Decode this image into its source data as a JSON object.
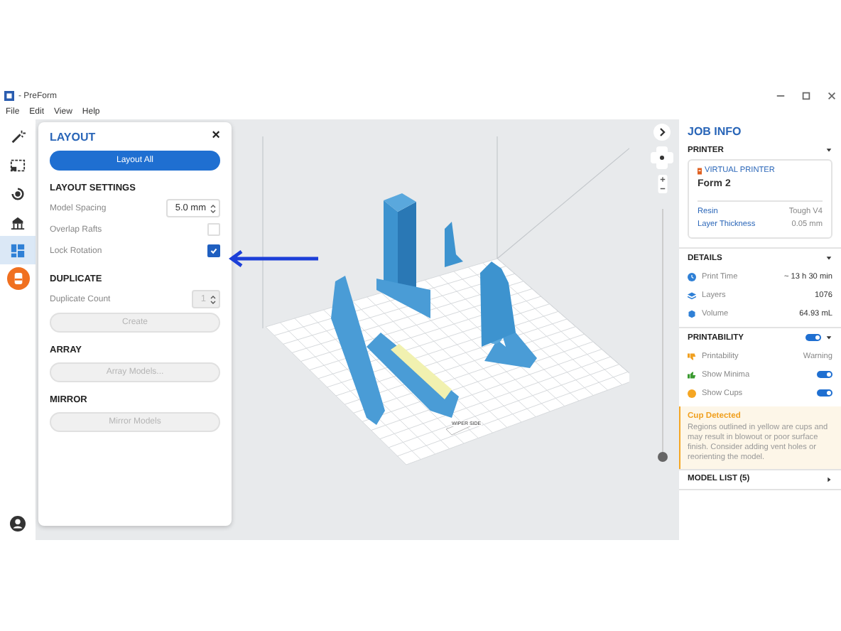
{
  "window": {
    "title": "- PreForm"
  },
  "menu": [
    "File",
    "Edit",
    "View",
    "Help"
  ],
  "toolbar": [
    {
      "kind": "wand",
      "selected": false
    },
    {
      "kind": "select",
      "selected": false
    },
    {
      "kind": "orient",
      "selected": false
    },
    {
      "kind": "supports",
      "selected": false
    },
    {
      "kind": "layout",
      "selected": true
    },
    {
      "kind": "print",
      "selected": false
    }
  ],
  "layout_panel": {
    "title": "LAYOUT",
    "close": "×",
    "layout_all": "Layout All",
    "sections": [
      {
        "heading": "LAYOUT SETTINGS",
        "rows": [
          {
            "kind": "spinner",
            "label": "Model Spacing",
            "value": "5.0 mm",
            "disabled": false
          },
          {
            "kind": "checkbox",
            "label": "Overlap Rafts",
            "checked": false
          },
          {
            "kind": "checkbox",
            "label": "Lock Rotation",
            "checked": true
          }
        ]
      },
      {
        "heading": "DUPLICATE",
        "rows": [
          {
            "kind": "spinner",
            "label": "Duplicate Count",
            "value": "1",
            "disabled": true
          },
          {
            "kind": "button",
            "label": "Create",
            "disabled": true
          }
        ]
      },
      {
        "heading": "ARRAY",
        "rows": [
          {
            "kind": "button",
            "label": "Array Models...",
            "disabled": true
          }
        ]
      },
      {
        "heading": "MIRROR",
        "rows": [
          {
            "kind": "button",
            "label": "Mirror Models",
            "disabled": true
          }
        ]
      }
    ]
  },
  "viewport": {
    "plate_label": "WIPER SIDE",
    "zoom": {
      "level": 0
    }
  },
  "job_info": {
    "title": "JOB INFO",
    "printer": {
      "heading": "PRINTER",
      "expanded": true,
      "badge": "VIRTUAL PRINTER",
      "model": "Form 2",
      "props": [
        {
          "label": "Resin",
          "value": "Tough V4"
        },
        {
          "label": "Layer Thickness",
          "value": "0.05 mm"
        }
      ]
    },
    "details": {
      "heading": "DETAILS",
      "expanded": true,
      "rows": [
        {
          "kind": "time",
          "label": "Print Time",
          "value": "~ 13 h 30 min"
        },
        {
          "kind": "layers",
          "label": "Layers",
          "value": "1076"
        },
        {
          "kind": "volume",
          "label": "Volume",
          "value": "64.93 mL"
        }
      ]
    },
    "printability": {
      "heading": "PRINTABILITY",
      "on": true,
      "expanded": true,
      "rows": [
        {
          "kind": "thumbdown",
          "label": "Printability",
          "value": "Warning"
        },
        {
          "kind": "thumbup",
          "label": "Show Minima",
          "on": true
        },
        {
          "kind": "cup",
          "label": "Show Cups",
          "on": true
        }
      ],
      "alert": {
        "title": "Cup Detected",
        "text": "Regions outlined in yellow are cups and may result in blowout or poor surface finish. Consider adding vent holes or reorienting the model."
      }
    },
    "model_list": {
      "heading": "MODEL LIST (5)",
      "expanded": false
    }
  }
}
